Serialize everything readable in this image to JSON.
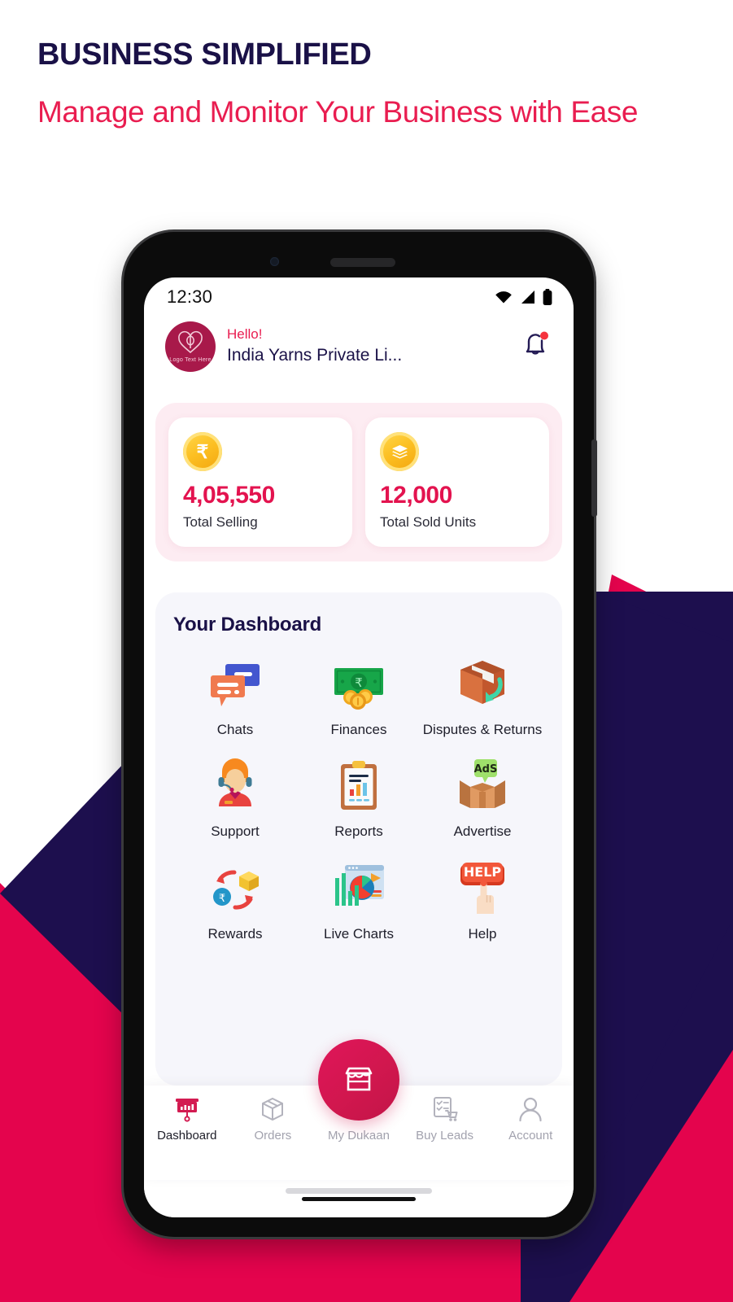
{
  "headline": {
    "eyebrow": "BUSINESS SIMPLIFIED",
    "subhead": "Manage and Monitor Your Business with Ease"
  },
  "colors": {
    "navy": "#1a1147",
    "crimson": "#e3134f",
    "pink_accent": "#e91d50",
    "bg_white": "#ffffff",
    "card_pink": "#fdecf2",
    "dash_card": "#f6f6fb",
    "coin_gold": "#fcbf22",
    "muted_nav": "#a2a2ae"
  },
  "phone": {
    "status_bar": {
      "time": "12:30",
      "icons": [
        "wifi-icon",
        "signal-icon",
        "battery-icon"
      ]
    },
    "app_header": {
      "avatar_logo_text": "Logo Text Here",
      "greeting": "Hello!",
      "business_name": "India Yarns Private Li...",
      "notification_icon": "bell-icon",
      "notification_has_badge": true
    },
    "stats": [
      {
        "icon": "rupee-coin-icon",
        "icon_glyph": "₹",
        "value": "4,05,550",
        "label": "Total Selling"
      },
      {
        "icon": "stacked-layers-coin-icon",
        "icon_glyph": "≣",
        "value": "12,000",
        "label": "Total Sold Units"
      }
    ],
    "dashboard": {
      "title": "Your Dashboard",
      "items": [
        {
          "label": "Chats",
          "icon": "chat-bubbles-icon"
        },
        {
          "label": "Finances",
          "icon": "banknote-coins-icon"
        },
        {
          "label": "Disputes\n& Returns",
          "icon": "return-box-icon"
        },
        {
          "label": "Support",
          "icon": "headset-agent-icon"
        },
        {
          "label": "Reports",
          "icon": "clipboard-chart-icon"
        },
        {
          "label": "Advertise",
          "icon": "ads-box-icon"
        },
        {
          "label": "Rewards",
          "icon": "rupee-cycle-box-icon"
        },
        {
          "label": "Live Charts",
          "icon": "pie-bar-window-icon"
        },
        {
          "label": "Help",
          "icon": "help-button-hand-icon"
        }
      ]
    },
    "bottom_nav": {
      "fab": {
        "label": "My Dukaan",
        "icon": "storefront-icon"
      },
      "items": [
        {
          "label": "Dashboard",
          "icon": "presentation-chart-icon",
          "active": true
        },
        {
          "label": "Orders",
          "icon": "package-box-icon",
          "active": false
        },
        {
          "label": "My Dukaan",
          "icon": "storefront-icon",
          "active": false
        },
        {
          "label": "Buy Leads",
          "icon": "checklist-cart-icon",
          "active": false
        },
        {
          "label": "Account",
          "icon": "person-icon",
          "active": false
        }
      ]
    }
  }
}
